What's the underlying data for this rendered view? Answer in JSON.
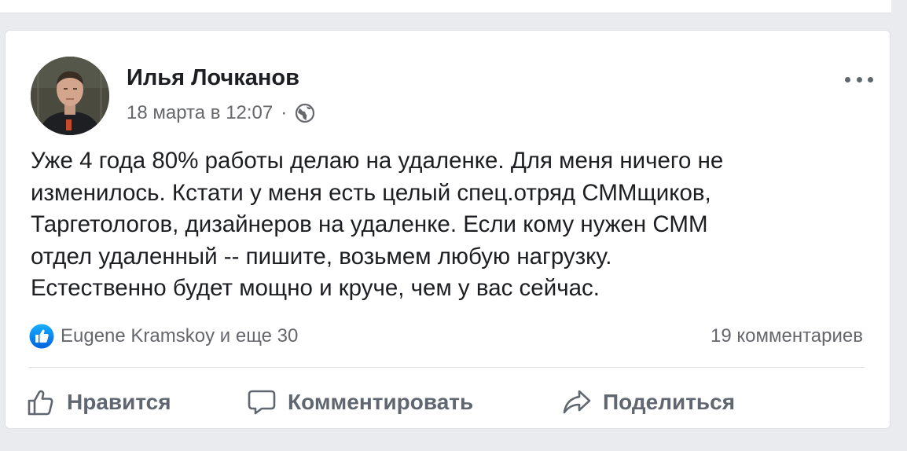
{
  "post": {
    "author": "Илья Лочканов",
    "date": "18 марта в 12:07",
    "separator": "·",
    "privacy_icon": "globe-icon",
    "more_icon": "more-options-icon",
    "text_lines": [
      "Уже 4 года 80% работы делаю на удаленке. Для меня ничего не",
      "изменилось. Кстати у меня есть целый спец.отряд СММщиков,",
      "Таргетологов, дизайнеров на удаленке. Если кому нужен СММ",
      "отдел удаленный -- пишите, возьмем любую нагрузку.",
      "Естественно будет мощно и круче, чем у вас сейчас."
    ],
    "reactions_text": "Eugene Kramskoy и еще 30",
    "comments_text": "19 комментариев"
  },
  "actions": {
    "like": "Нравится",
    "comment": "Комментировать",
    "share": "Поделиться"
  },
  "colors": {
    "background": "#e9ebee",
    "card": "#ffffff",
    "text_primary": "#1c1e21",
    "text_secondary": "#65676b",
    "like_blue": "#1877f2"
  }
}
